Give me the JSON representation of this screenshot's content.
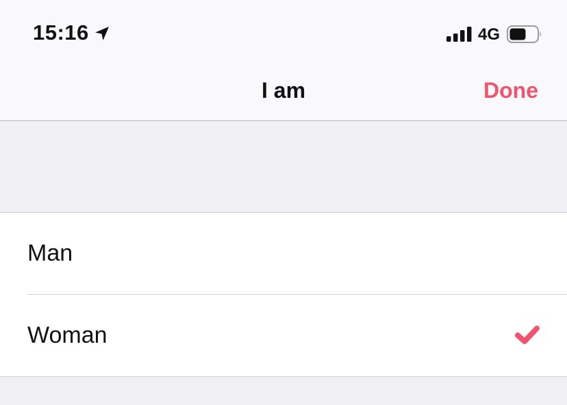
{
  "status_bar": {
    "time": "15:16",
    "network": "4G",
    "location_icon": "location-arrow-icon",
    "signal_icon": "cellular-signal-icon",
    "battery_icon": "battery-icon"
  },
  "nav": {
    "title": "I am",
    "done_label": "Done"
  },
  "options": [
    {
      "label": "Man",
      "selected": false
    },
    {
      "label": "Woman",
      "selected": true
    }
  ],
  "colors": {
    "accent": "#f1546e",
    "background": "#f0eff4",
    "bar_background": "#f9f9fb"
  }
}
